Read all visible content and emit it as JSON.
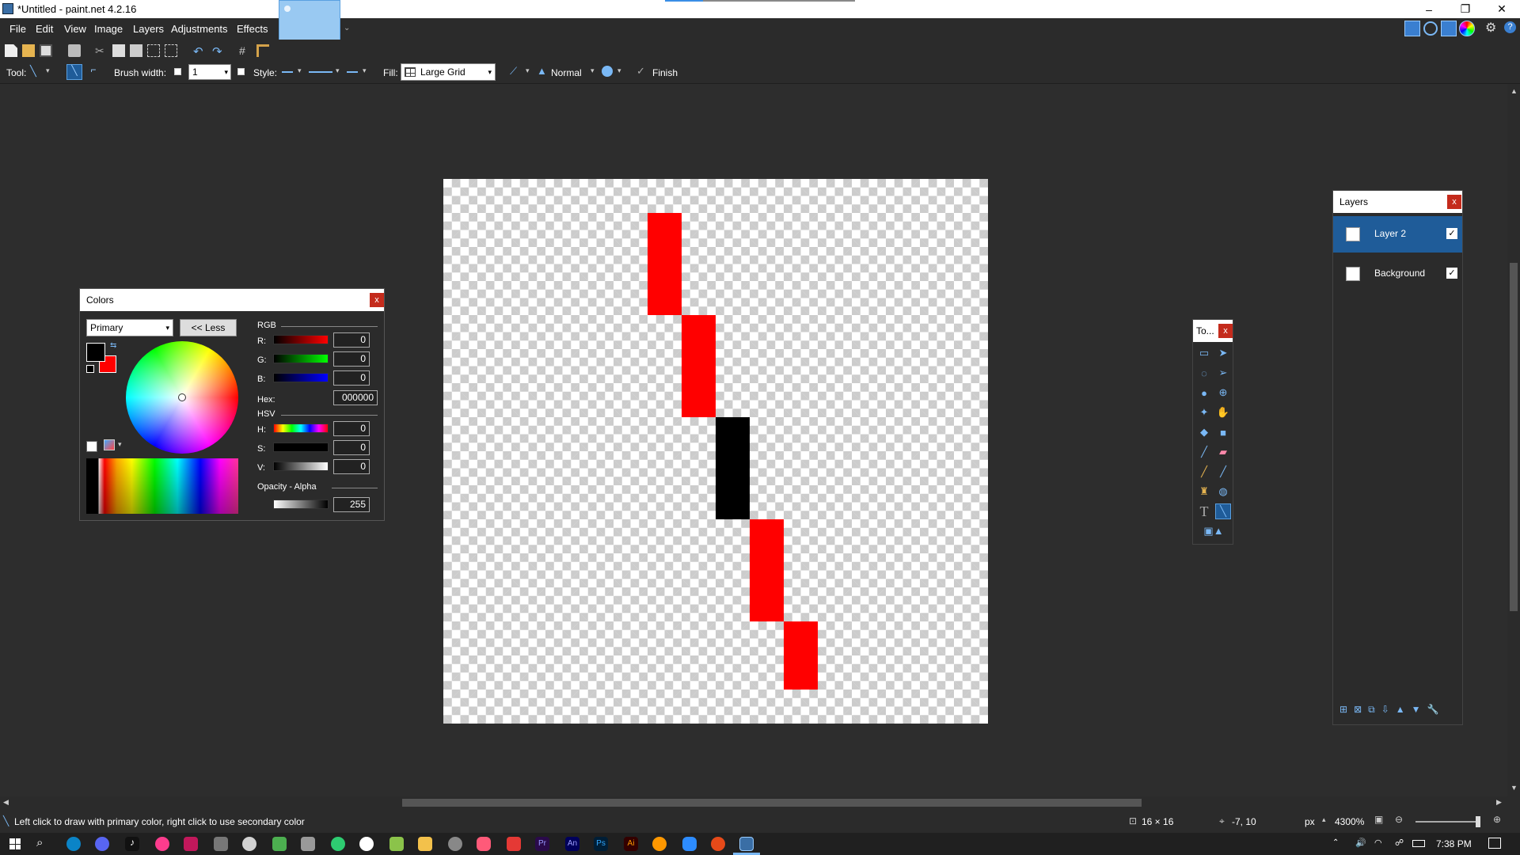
{
  "window": {
    "title": "*Untitled - paint.net 4.2.16"
  },
  "menu": [
    "File",
    "Edit",
    "View",
    "Image",
    "Layers",
    "Adjustments",
    "Effects"
  ],
  "toolbar": {
    "tool_label": "Tool:",
    "brush_width_label": "Brush width:",
    "brush_width_value": "1",
    "style_label": "Style:",
    "fill_label": "Fill:",
    "fill_value": "Large Grid",
    "blend_mode": "Normal",
    "finish_label": "Finish"
  },
  "colors_panel": {
    "title": "Colors",
    "target": "Primary",
    "less_button": "<< Less",
    "rgb_label": "RGB",
    "r_label": "R:",
    "g_label": "G:",
    "b_label": "B:",
    "r": "0",
    "g": "0",
    "b": "0",
    "hex_label": "Hex:",
    "hex": "000000",
    "hsv_label": "HSV",
    "h_label": "H:",
    "s_label": "S:",
    "v_label": "V:",
    "h": "0",
    "s": "0",
    "v": "0",
    "opacity_label": "Opacity - Alpha",
    "alpha": "255",
    "primary_color": "#000000",
    "secondary_color": "#ff0000"
  },
  "tools_panel": {
    "title": "To..."
  },
  "layers_panel": {
    "title": "Layers",
    "layers": [
      {
        "name": "Layer 2",
        "visible": true,
        "selected": true
      },
      {
        "name": "Background",
        "visible": true,
        "selected": false
      }
    ]
  },
  "status": {
    "hint": "Left click to draw with primary color, right click to use secondary color",
    "image_size": "16 × 16",
    "cursor_pos": "-7, 10",
    "units": "px",
    "zoom": "4300%"
  },
  "clock": {
    "time": "7:38 PM"
  },
  "canvas_pixels": [
    {
      "col": 6,
      "row": 1,
      "color": "#ff0000",
      "rows_tall": 3
    },
    {
      "col": 7,
      "row": 4,
      "color": "#ff0000",
      "rows_tall": 3
    },
    {
      "col": 8,
      "row": 7,
      "color": "#000000",
      "rows_tall": 3
    },
    {
      "col": 9,
      "row": 10,
      "color": "#ff0000",
      "rows_tall": 3
    },
    {
      "col": 10,
      "row": 13,
      "color": "#ff0000",
      "rows_tall": 2
    }
  ]
}
